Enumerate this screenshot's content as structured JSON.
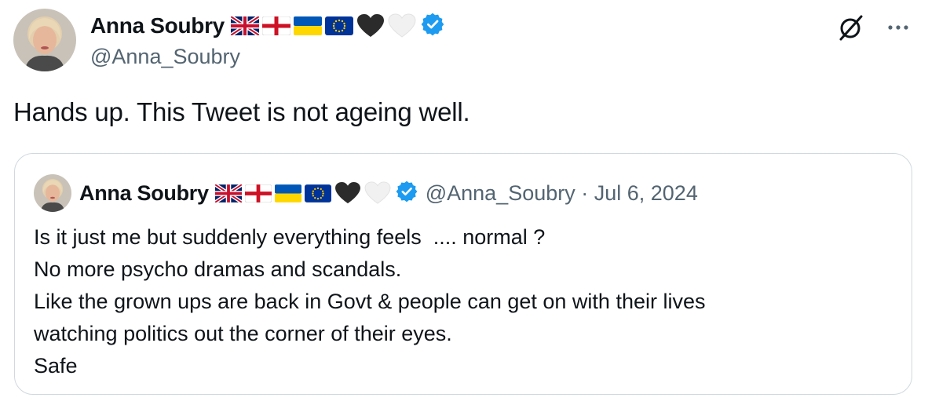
{
  "tweet": {
    "author": {
      "display_name": "Anna Soubry",
      "handle": "@Anna_Soubry",
      "emoji_flags": [
        "uk-flag",
        "england-flag",
        "ukraine-flag",
        "eu-flag",
        "black-heart",
        "white-heart"
      ],
      "verified": true
    },
    "text": "Hands up. This Tweet is not ageing well.",
    "icons": {
      "grok": "grok-icon",
      "more": "more-icon"
    },
    "quote": {
      "author": {
        "display_name": "Anna Soubry",
        "handle": "@Anna_Soubry",
        "verified": true
      },
      "handle_date": "@Anna_Soubry · Jul 6, 2024",
      "lines": [
        "Is it just me but suddenly everything feels  .... normal ?",
        "No more psycho dramas and scandals.",
        "Like the grown ups are back in Govt & people can get on with their lives",
        "watching politics out the corner of their eyes.",
        "Safe"
      ]
    }
  },
  "colors": {
    "text": "#0f1419",
    "secondary": "#536471",
    "border": "#cfd9de",
    "verified_blue": "#1d9bf0"
  }
}
